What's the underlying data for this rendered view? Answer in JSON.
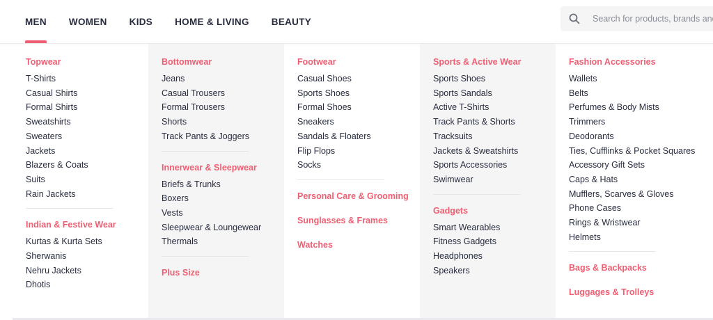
{
  "nav": [
    {
      "label": "MEN"
    },
    {
      "label": "WOMEN"
    },
    {
      "label": "KIDS"
    },
    {
      "label": "HOME & LIVING"
    },
    {
      "label": "BEAUTY"
    }
  ],
  "search": {
    "placeholder": "Search for products, brands and m"
  },
  "columns": [
    {
      "groups": [
        {
          "title": "Topwear",
          "items": [
            "T-Shirts",
            "Casual Shirts",
            "Formal Shirts",
            "Sweatshirts",
            "Sweaters",
            "Jackets",
            "Blazers & Coats",
            "Suits",
            "Rain Jackets"
          ]
        },
        {
          "title": "Indian & Festive Wear",
          "items": [
            "Kurtas & Kurta Sets",
            "Sherwanis",
            "Nehru Jackets",
            "Dhotis"
          ]
        }
      ]
    },
    {
      "groups": [
        {
          "title": "Bottomwear",
          "items": [
            "Jeans",
            "Casual Trousers",
            "Formal Trousers",
            "Shorts",
            "Track Pants & Joggers"
          ]
        },
        {
          "title": "Innerwear & Sleepwear",
          "items": [
            "Briefs & Trunks",
            "Boxers",
            "Vests",
            "Sleepwear & Loungewear",
            "Thermals"
          ]
        },
        {
          "title": "Plus Size",
          "items": []
        }
      ]
    },
    {
      "groups": [
        {
          "title": "Footwear",
          "items": [
            "Casual Shoes",
            "Sports Shoes",
            "Formal Shoes",
            "Sneakers",
            "Sandals & Floaters",
            "Flip Flops",
            "Socks"
          ]
        }
      ],
      "extras": [
        "Personal Care & Grooming",
        "Sunglasses & Frames",
        "Watches"
      ]
    },
    {
      "groups": [
        {
          "title": "Sports & Active Wear",
          "items": [
            "Sports Shoes",
            "Sports Sandals",
            "Active T-Shirts",
            "Track Pants & Shorts",
            "Tracksuits",
            "Jackets & Sweatshirts",
            "Sports Accessories",
            "Swimwear"
          ]
        },
        {
          "title": "Gadgets",
          "items": [
            "Smart Wearables",
            "Fitness Gadgets",
            "Headphones",
            "Speakers"
          ]
        }
      ]
    },
    {
      "groups": [
        {
          "title": "Fashion Accessories",
          "items": [
            "Wallets",
            "Belts",
            "Perfumes & Body Mists",
            "Trimmers",
            "Deodorants",
            "Ties, Cufflinks & Pocket Squares",
            "Accessory Gift Sets",
            "Caps & Hats",
            "Mufflers, Scarves & Gloves",
            "Phone Cases",
            "Rings & Wristwear",
            "Helmets"
          ]
        }
      ],
      "extras": [
        "Bags & Backpacks",
        "Luggages & Trolleys"
      ]
    }
  ],
  "colors": {
    "accent": "#ee5f73",
    "text": "#282c3f",
    "alt_bg": "#f5f5f6"
  }
}
